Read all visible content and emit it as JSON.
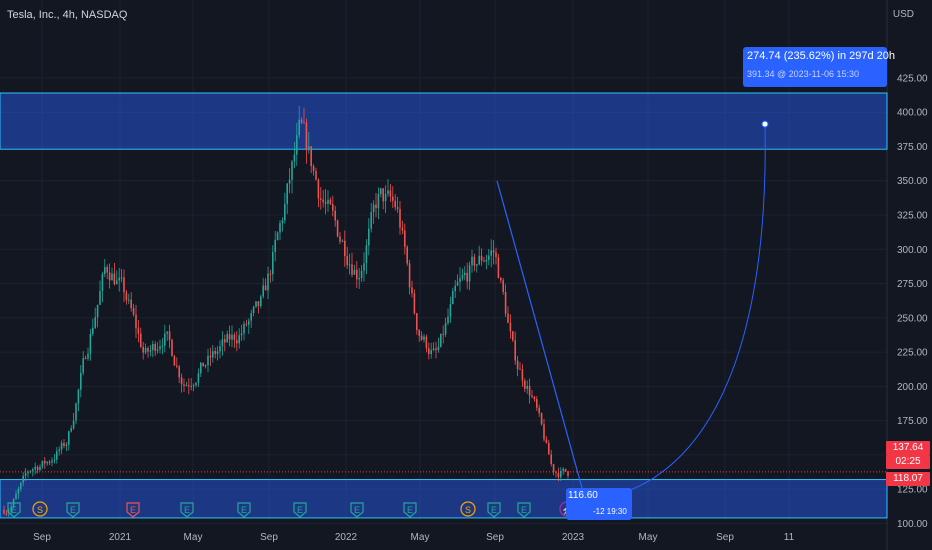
{
  "header": {
    "title": "Tesla, Inc., 4h, NASDAQ",
    "currency": "USD"
  },
  "axis": {
    "y_ticks": [
      100,
      125,
      150,
      175,
      200,
      225,
      250,
      275,
      300,
      325,
      350,
      375,
      400,
      425
    ],
    "y_tick_labels": [
      "100.00",
      "125.00",
      "150.00",
      "175.00",
      "200.00",
      "225.00",
      "250.00",
      "275.00",
      "300.00",
      "325.00",
      "350.00",
      "375.00",
      "400.00",
      "425.00"
    ],
    "x_ticks": [
      "Sep",
      "2021",
      "May",
      "Sep",
      "2022",
      "May",
      "Sep",
      "2023",
      "May",
      "Sep",
      "11"
    ]
  },
  "price_tags": {
    "last": "137.64",
    "countdown": "02:25",
    "low_level": "118.07"
  },
  "measure": {
    "line1": "274.74 (235.62%) in 297d 20h",
    "line2": "391.34 @ 2023-11-06  15:30"
  },
  "start_point": {
    "price": "116.60",
    "time": "-12 19:30"
  },
  "event_markers": [
    "E",
    "S",
    "E",
    "E",
    "E",
    "E",
    "E",
    "E",
    "E",
    "S",
    "E",
    "E",
    "E",
    "E",
    "E"
  ],
  "colors": {
    "background": "#131722",
    "up": "#26a69a",
    "down": "#ef5350",
    "zone": "#2962ff",
    "zone_border": "#2ec4ff",
    "measure": "#2962ff",
    "last_price": "#f23645"
  },
  "chart_data": {
    "type": "candlestick",
    "symbol": "Tesla, Inc.",
    "timeframe": "4h",
    "exchange": "NASDAQ",
    "x": [
      "2020-08",
      "2020-09",
      "2020-10",
      "2020-11",
      "2020-12",
      "2021-01",
      "2021-02",
      "2021-03",
      "2021-04",
      "2021-05",
      "2021-06",
      "2021-07",
      "2021-08",
      "2021-09",
      "2021-10",
      "2021-11",
      "2021-12",
      "2022-01",
      "2022-02",
      "2022-03",
      "2022-04",
      "2022-05",
      "2022-06",
      "2022-07",
      "2022-08",
      "2022-09",
      "2022-10",
      "2022-11",
      "2022-12"
    ],
    "close_approx": [
      110,
      140,
      145,
      160,
      230,
      290,
      265,
      220,
      240,
      200,
      215,
      230,
      240,
      260,
      320,
      390,
      340,
      310,
      280,
      340,
      330,
      240,
      220,
      270,
      290,
      300,
      220,
      190,
      137
    ],
    "ylim": [
      95,
      432
    ],
    "zones": [
      {
        "name": "resistance zone",
        "low": 373,
        "high": 414
      },
      {
        "name": "support zone",
        "low": 104,
        "high": 132
      }
    ],
    "trendline": {
      "from": {
        "x": "2022-09",
        "y": 350
      },
      "to": {
        "x": "2023-01",
        "y": 118
      }
    },
    "projection": {
      "from": {
        "x": "2023-01-12",
        "y": 116.6
      },
      "to": {
        "x": "2023-11-06",
        "y": 391.34
      },
      "change": 274.74,
      "change_pct": 235.62
    },
    "last_price": 137.64,
    "horizontal_level": 118.07
  }
}
